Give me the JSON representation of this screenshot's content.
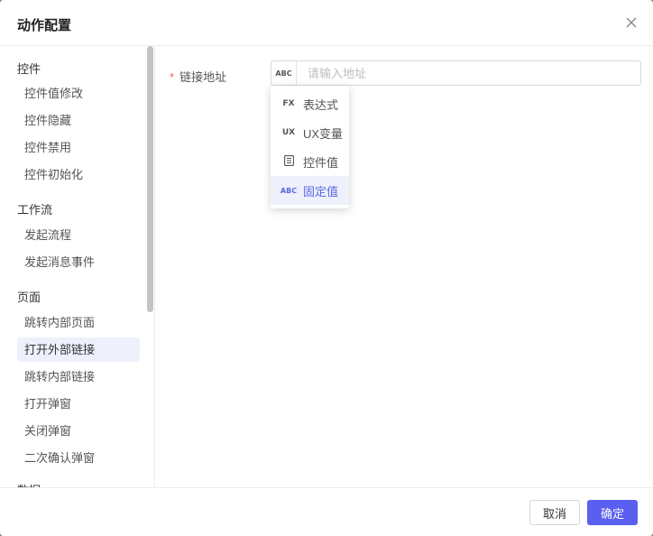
{
  "dialog": {
    "title": "动作配置"
  },
  "sidebar": {
    "groups": [
      {
        "title": "控件",
        "items": [
          "控件值修改",
          "控件隐藏",
          "控件禁用",
          "控件初始化"
        ]
      },
      {
        "title": "工作流",
        "items": [
          "发起流程",
          "发起消息事件"
        ]
      },
      {
        "title": "页面",
        "items": [
          "跳转内部页面",
          "打开外部链接",
          "跳转内部链接",
          "打开弹窗",
          "关闭弹窗",
          "二次确认弹窗"
        ]
      },
      {
        "title": "数据"
      }
    ],
    "active_item": "打开外部链接"
  },
  "form": {
    "required_mark": "*",
    "label": "链接地址",
    "prefix_badge": "ABC",
    "placeholder": "请输入地址",
    "value": ""
  },
  "dropdown": {
    "items": [
      {
        "icon_text": "FX",
        "label": "表达式"
      },
      {
        "icon_text": "UX",
        "label": "UX变量"
      },
      {
        "icon": "list-icon",
        "label": "控件值"
      },
      {
        "icon_text": "ABC",
        "label": "固定值"
      }
    ],
    "selected": "固定值"
  },
  "footer": {
    "cancel": "取消",
    "confirm": "确定"
  },
  "colors": {
    "primary": "#5b5ff0",
    "active_bg": "#eef0fc",
    "required": "#f25d5d"
  }
}
